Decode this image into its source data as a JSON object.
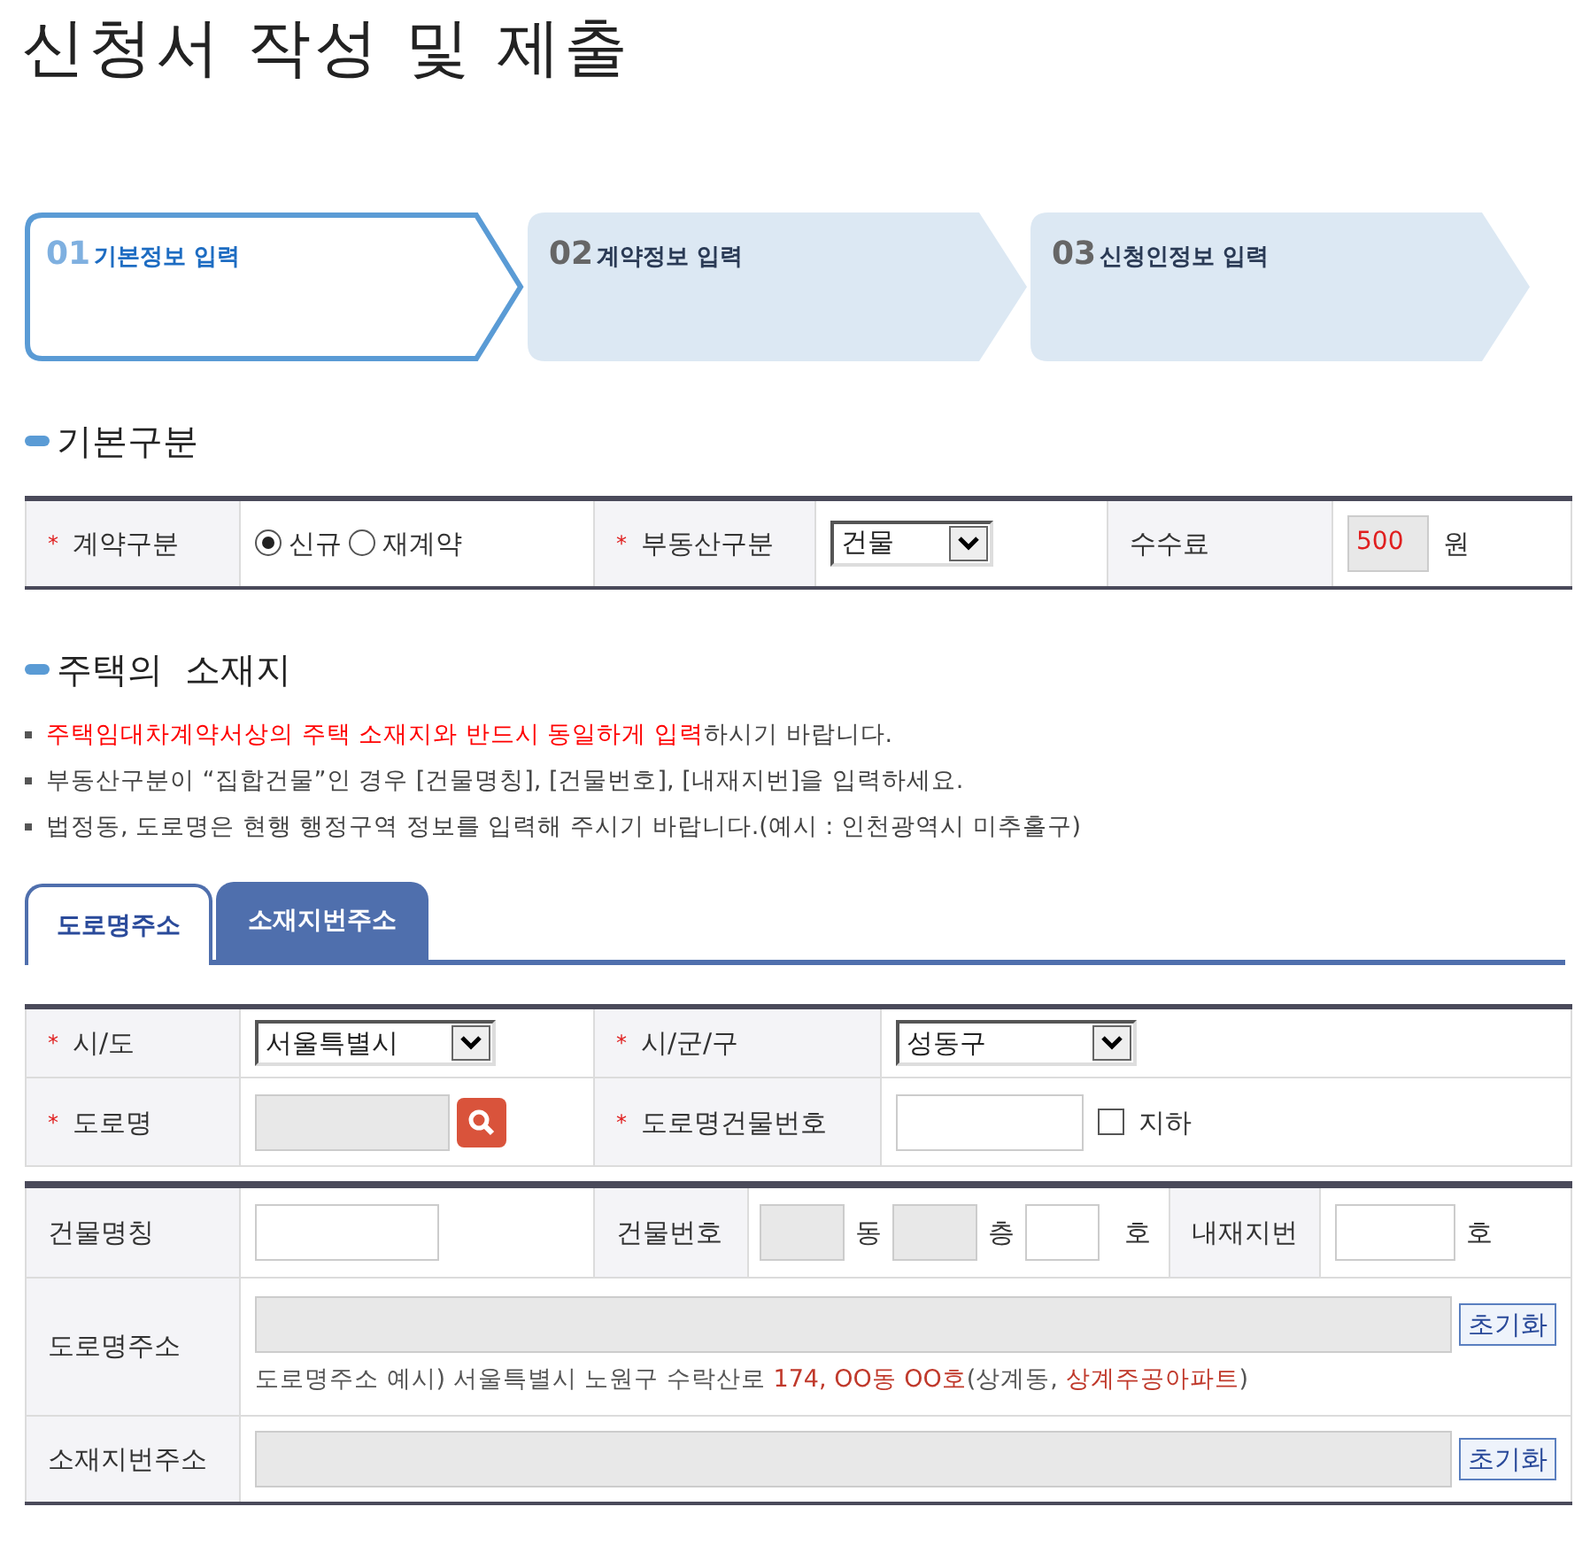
{
  "title": "신청서 작성 및 제출",
  "steps": [
    {
      "number": "01",
      "label": "기본정보 입력",
      "selected": true
    },
    {
      "number": "02",
      "label": "계약정보 입력",
      "selected": false
    },
    {
      "number": "03",
      "label": "신청인정보 입력",
      "selected": false
    }
  ],
  "basic": {
    "heading": "기본구분",
    "contract": {
      "label": "계약구분",
      "mark": "*",
      "options": [
        {
          "label": "신규",
          "selected": true
        },
        {
          "label": "재계약",
          "selected": false
        }
      ]
    },
    "property": {
      "label": "부동산구분",
      "mark": "*",
      "value": "건물"
    },
    "fee": {
      "label": "수수료",
      "value": "500",
      "unit": "원"
    }
  },
  "location": {
    "heading": "주택의  소재지",
    "notes": [
      [
        {
          "text": "주택임대차계약서상의 주택 소재지와 반드시 동일하게 입력",
          "highlight": true
        },
        {
          "text": "하시기 바랍니다.",
          "highlight": false
        }
      ],
      [
        {
          "text": "부동산구분이 “집합건물”인 경우 [건물명칭], [건물번호], [내재지번]을 입력하세요.",
          "highlight": false
        }
      ],
      [
        {
          "text": "법정동, 도로명은 현행 행정구역 정보를 입력해 주시기 바랍니다.(예시 : 인천광역시 미추홀구)",
          "highlight": false
        }
      ]
    ],
    "tabs": [
      {
        "label": "도로명주소",
        "selected": true
      },
      {
        "label": "소재지번주소",
        "selected": false
      }
    ],
    "sido": {
      "label": "시/도",
      "mark": "*",
      "value": "서울특별시"
    },
    "sigungu": {
      "label": "시/군/구",
      "mark": "*",
      "value": "성동구"
    },
    "road": {
      "label": "도로명",
      "mark": "*"
    },
    "building_number": {
      "label": "도로명건물번호",
      "mark": "*"
    },
    "basement": {
      "label": "지하",
      "checked": false
    },
    "building_name": {
      "label": "건물명칭"
    },
    "building_no": {
      "label": "건물번호",
      "dong": "동",
      "floor": "층",
      "ho": "호"
    },
    "inner_lot": {
      "label": "내재지번",
      "unit": "호"
    },
    "road_address": {
      "label": "도로명주소",
      "reset": "초기화",
      "example": [
        {
          "text": "도로명주소 예시) 서울특별시 노원구 수락산로 ",
          "highlight": false
        },
        {
          "text": "174, OO동 OO호",
          "highlight": true
        },
        {
          "text": "(상계동, ",
          "highlight": false
        },
        {
          "text": "상계주공아파트",
          "highlight": true
        },
        {
          "text": ")",
          "highlight": false
        }
      ]
    },
    "lot_address": {
      "label": "소재지번주소",
      "reset": "초기화"
    }
  }
}
